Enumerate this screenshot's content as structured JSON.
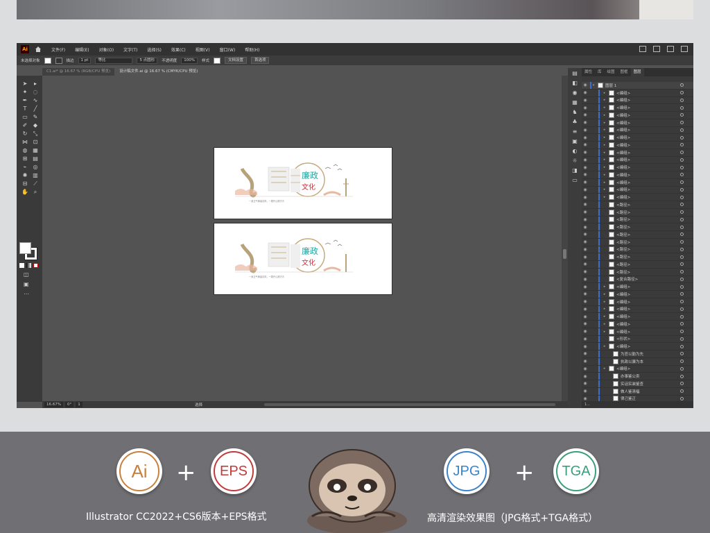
{
  "menu": {
    "app_logo": "Ai",
    "items": [
      "文件(F)",
      "编辑(E)",
      "对象(O)",
      "文字(T)",
      "选择(S)",
      "效果(C)",
      "视图(V)",
      "窗口(W)",
      "帮助(H)"
    ]
  },
  "options_bar": {
    "selection": "未选择对象",
    "stroke_label": "描边",
    "stroke_value": "1 pt",
    "brush": "等比",
    "points": "5 点圆形",
    "opacity_label": "不透明度",
    "opacity_value": "100%",
    "style_label": "样式",
    "doc_setup": "文档设置",
    "preferences": "首选项"
  },
  "tabs": [
    {
      "label": "C1.ai* @ 16.67 % (RGB/CPU 预览)",
      "active": false
    },
    {
      "label": "设计稿文件.ai @ 16.67 % (CMYK/CPU 预览)",
      "active": true
    }
  ],
  "status": {
    "zoom": "16.67%",
    "rotation": "0°",
    "page": "1",
    "tool": "选择"
  },
  "layers_panel": {
    "tabs": [
      "属性",
      "库",
      "绘图",
      "图框",
      "图层"
    ],
    "active_tab": "图层",
    "top_layer": "图层 1",
    "rows": [
      "<编组>",
      "<编组>",
      "<编组>",
      "<编组>",
      "<编组>",
      "<编组>",
      "<编组>",
      "<编组>",
      "<编组>",
      "<编组>",
      "<编组>",
      "<编组>",
      "<编组>",
      "<编组>",
      "<编组>",
      "<路径>",
      "<路径>",
      "<路径>",
      "<路径>",
      "<路径>",
      "<路径>",
      "<路径>",
      "<路径>",
      "<路径>",
      "<路径>",
      "<复合路径>",
      "<编组>",
      "<编组>",
      "<编组>",
      "<编组>",
      "<编组>",
      "<编组>",
      "<编组>",
      "<形状>",
      "<编组>",
      "为官以勤为先",
      "执政以廉为本",
      "<编组>",
      "办事鉴公卖",
      "实话实装鉴查",
      "做人鉴清福",
      "律己鉴正",
      "廉工志强",
      "立时德在先"
    ],
    "footer": "1..."
  },
  "artwork": {
    "title_top": "廉政",
    "title_bottom": "文化",
    "tagline": "一身正气两袖清风，一颗丹心照汗青"
  },
  "bottom": {
    "badges": [
      "Ai",
      "EPS",
      "JPG",
      "TGA"
    ],
    "plus": "+",
    "caption_left": "Illustrator CC2022+CS6版本+EPS格式",
    "caption_right": "高清渲染效果图（JPG格式+TGA格式）"
  },
  "colors": {
    "ai_ring": "#c8813c",
    "eps_ring": "#c23a3a",
    "jpg_ring": "#3c83c8",
    "tga_ring": "#3a9e7a",
    "layer_accent": "#3c6fd0",
    "teal_title": "#2aa6a0",
    "red_title": "#c7323a"
  }
}
